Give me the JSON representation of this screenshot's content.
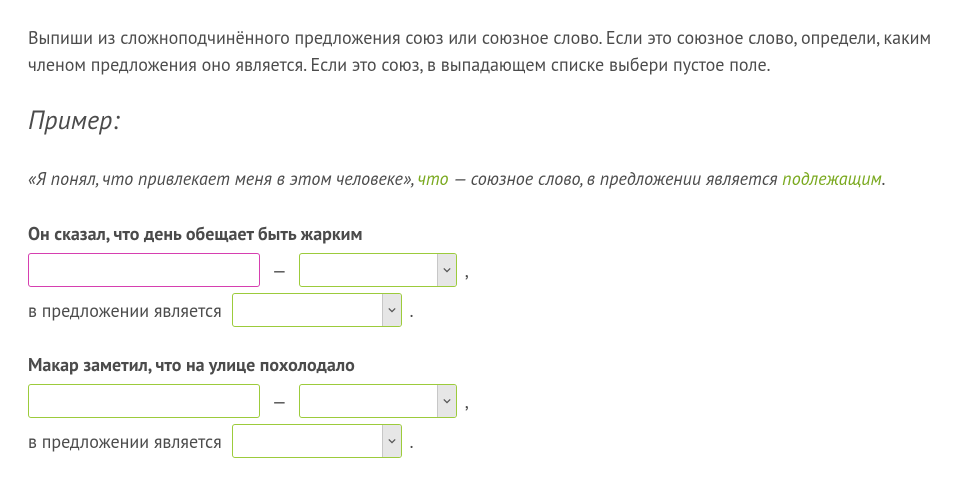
{
  "instructions": "Выпиши из сложноподчинённого предложения союз или союзное слово. Если это союзное слово, определи, каким членом предложения оно является. Если это союз, в выпадающем списке выбери пустое поле.",
  "example": {
    "heading": "Пример:",
    "quote": "«Я понял, что привлекает меня в этом человеке», ",
    "word": "что",
    "middle": " — союзное слово, в предложении является ",
    "role": "подлежащим",
    "tail": "."
  },
  "punct": {
    "dash": "—",
    "comma": ",",
    "period": "."
  },
  "labels": {
    "role_prefix": "в предложении является"
  },
  "tasks": [
    {
      "sentence": "Он сказал, что день обещает быть жарким",
      "input_value": "",
      "type_value": "",
      "role_value": ""
    },
    {
      "sentence": "Макар заметил, что на улице похолодало",
      "input_value": "",
      "type_value": "",
      "role_value": ""
    }
  ]
}
